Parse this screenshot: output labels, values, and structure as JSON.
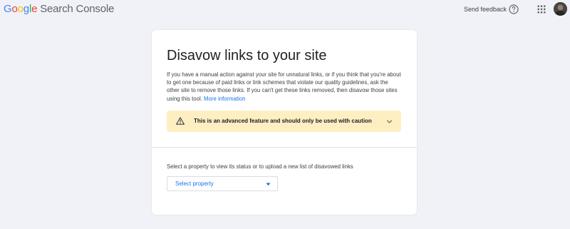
{
  "header": {
    "logo_letters": [
      "G",
      "o",
      "o",
      "g",
      "l",
      "e"
    ],
    "product_name": "Search Console",
    "send_feedback": "Send feedback",
    "help_icon": "help-circle-icon",
    "apps_icon": "apps-grid-icon",
    "avatar": "user-avatar"
  },
  "card": {
    "title": "Disavow links to your site",
    "description": "If you have a manual action against your site for unnatural links, or if you think that you're about to get one because of paid links or link schemes that violate our quality guidelines, ask the other site to remove those links. If you can't get these links removed, then disavow those sites using this tool.",
    "more_info_link": "More information",
    "caution": {
      "text": "This is an advanced feature and should only be used with caution",
      "icon": "warning-icon",
      "expand_icon": "chevron-down-icon"
    },
    "property_prompt": "Select a property to view its status or to upload a new list of disavowed links",
    "select_property_label": "Select property"
  },
  "colors": {
    "background": "#f0f2f7",
    "card": "#ffffff",
    "caution_bg": "#feefc3",
    "link_blue": "#1a73e8",
    "google_blue": "#4285f4",
    "google_red": "#ea4335",
    "google_yellow": "#fbbc05",
    "google_green": "#34a853"
  }
}
